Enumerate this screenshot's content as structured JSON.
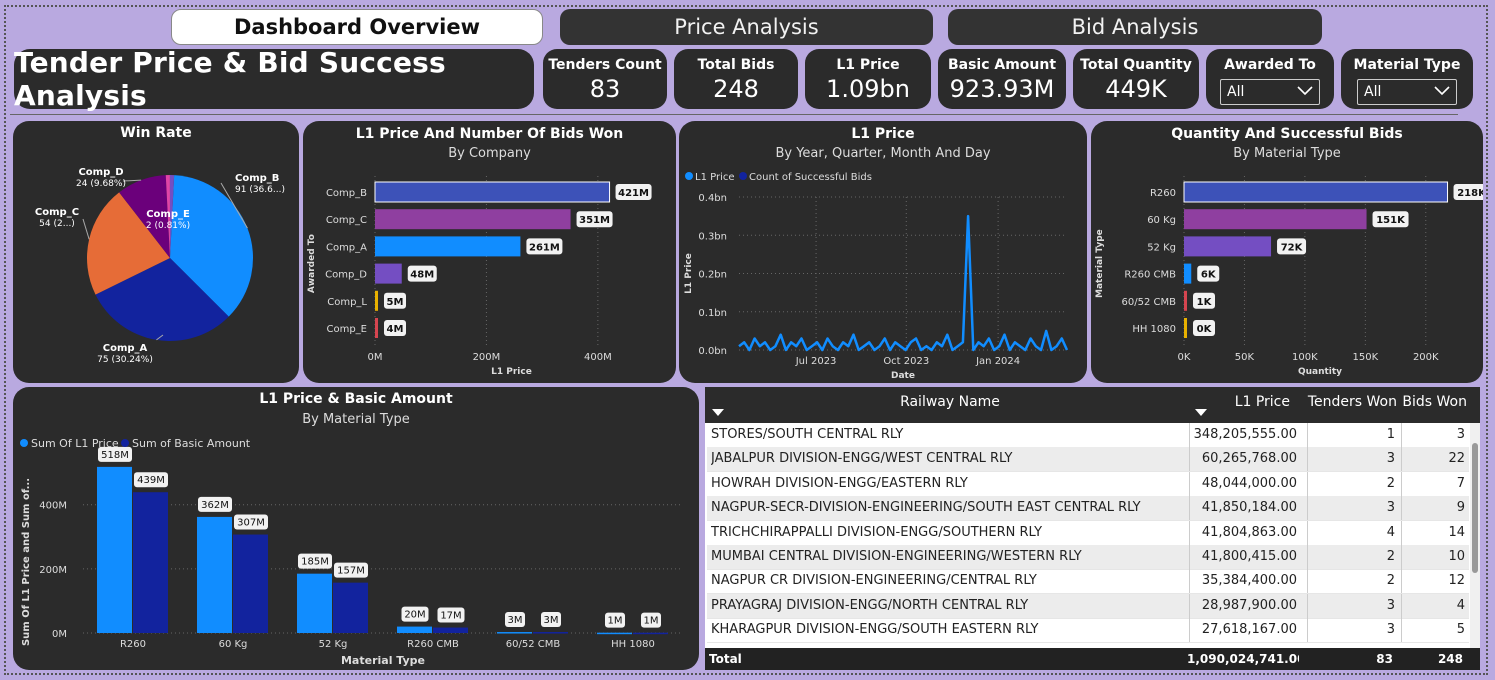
{
  "tabs": [
    {
      "label": "Dashboard Overview",
      "active": true
    },
    {
      "label": "Price Analysis",
      "active": false
    },
    {
      "label": "Bid Analysis",
      "active": false
    }
  ],
  "dashboard_title": "Tender Price & Bid Success Analysis",
  "kpis": [
    {
      "label": "Tenders Count",
      "value": "83"
    },
    {
      "label": "Total Bids",
      "value": "248"
    },
    {
      "label": "L1 Price",
      "value": "1.09bn"
    },
    {
      "label": "Basic Amount",
      "value": "923.93M"
    },
    {
      "label": "Total Quantity",
      "value": "449K"
    }
  ],
  "slicers": [
    {
      "label": "Awarded To",
      "selected": "All"
    },
    {
      "label": "Material Type",
      "selected": "All"
    }
  ],
  "chart_data": [
    {
      "id": "win-rate",
      "type": "pie",
      "title": "Win Rate",
      "slices": [
        {
          "name": "Comp_B",
          "value": 91,
          "label": "91 (36.6...)",
          "color": "#118dff"
        },
        {
          "name": "Comp_A",
          "value": 75,
          "label": "75 (30.24%)",
          "color": "#12239e"
        },
        {
          "name": "Comp_C",
          "value": 54,
          "label": "54 (2...)",
          "color": "#e66c37"
        },
        {
          "name": "Comp_D",
          "value": 24,
          "label": "24 (9.68%)",
          "color": "#6b007b"
        },
        {
          "name": "Comp_L",
          "value": 2,
          "label": "",
          "color": "#e044a7"
        },
        {
          "name": "Comp_E",
          "value": 2,
          "label": "2 (0.81%)",
          "color": "#744ec2"
        }
      ]
    },
    {
      "id": "l1-by-company",
      "type": "bar",
      "orientation": "horizontal",
      "title": "L1 Price And Number Of Bids Won",
      "subtitle": "By Company",
      "xlabel": "L1 Price",
      "ylabel": "Awarded To",
      "xlim": [
        0,
        490
      ],
      "xticks": [
        {
          "v": 0,
          "t": "0M"
        },
        {
          "v": 200,
          "t": "200M"
        },
        {
          "v": 400,
          "t": "400M"
        }
      ],
      "categories": [
        "Comp_B",
        "Comp_C",
        "Comp_A",
        "Comp_D",
        "Comp_L",
        "Comp_E"
      ],
      "values": [
        421,
        351,
        261,
        48,
        5,
        4
      ],
      "labels": [
        "421M",
        "351M",
        "261M",
        "48M",
        "5M",
        "4M"
      ],
      "colors": [
        "#3d52b8",
        "#8f3fa0",
        "#118dff",
        "#744ec2",
        "#e8b100",
        "#d64550"
      ]
    },
    {
      "id": "l1-by-date",
      "type": "line",
      "title": "L1 Price",
      "subtitle": "By Year, Quarter, Month And Day",
      "legend": [
        "L1 Price",
        "Count of Successful Bids"
      ],
      "legend_colors": [
        "#118dff",
        "#12239e"
      ],
      "xlabel": "Date",
      "ylabel": "L1 Price",
      "ylim": [
        0,
        0.4
      ],
      "yticks": [
        {
          "v": 0,
          "t": "0.0bn"
        },
        {
          "v": 0.1,
          "t": "0.1bn"
        },
        {
          "v": 0.2,
          "t": "0.2bn"
        },
        {
          "v": 0.3,
          "t": "0.3bn"
        },
        {
          "v": 0.4,
          "t": "0.4bn"
        }
      ],
      "xticks": [
        "Jul 2023",
        "Oct 2023",
        "Jan 2024"
      ],
      "values": [
        0.01,
        0.02,
        0.0,
        0.03,
        0.01,
        0.02,
        0.0,
        0.01,
        0.04,
        0.0,
        0.02,
        0.01,
        0.03,
        0.0,
        0.01,
        0.02,
        0.0,
        0.03,
        0.01,
        0.0,
        0.02,
        0.01,
        0.04,
        0.0,
        0.01,
        0.02,
        0.0,
        0.01,
        0.03,
        0.0,
        0.02,
        0.01,
        0.0,
        0.02,
        0.03,
        0.0,
        0.01,
        0.0,
        0.02,
        0.01,
        0.04,
        0.0,
        0.01,
        0.02,
        0.35,
        0.0,
        0.02,
        0.01,
        0.03,
        0.0,
        0.01,
        0.04,
        0.0,
        0.02,
        0.01,
        0.0,
        0.03,
        0.01,
        0.0,
        0.05,
        0.0,
        0.01,
        0.03,
        0.0
      ]
    },
    {
      "id": "qty-by-material",
      "type": "bar",
      "orientation": "horizontal",
      "title": "Quantity And Successful Bids",
      "subtitle": "By Material Type",
      "xlabel": "Quantity",
      "ylabel": "Material Type",
      "xlim": [
        0,
        225
      ],
      "xticks": [
        {
          "v": 0,
          "t": "0K"
        },
        {
          "v": 50,
          "t": "50K"
        },
        {
          "v": 100,
          "t": "100K"
        },
        {
          "v": 150,
          "t": "150K"
        },
        {
          "v": 200,
          "t": "200K"
        }
      ],
      "categories": [
        "R260",
        "60 Kg",
        "52 Kg",
        "R260 CMB",
        "60/52 CMB",
        "HH 1080"
      ],
      "values": [
        218,
        151,
        72,
        6,
        1,
        0.3
      ],
      "labels": [
        "218K",
        "151K",
        "72K",
        "6K",
        "1K",
        "0K"
      ],
      "colors": [
        "#3d52b8",
        "#8f3fa0",
        "#744ec2",
        "#118dff",
        "#d64550",
        "#e8b100"
      ]
    },
    {
      "id": "l1-basic-by-material",
      "type": "bar",
      "orientation": "vertical",
      "title": "L1 Price & Basic Amount",
      "subtitle": "By Material Type",
      "xlabel": "Material Type",
      "ylabel": "Sum Of L1 Price and Sum of...",
      "ylim": [
        0,
        580
      ],
      "yticks": [
        {
          "v": 0,
          "t": "0M"
        },
        {
          "v": 200,
          "t": "200M"
        },
        {
          "v": 400,
          "t": "400M"
        }
      ],
      "categories": [
        "R260",
        "60 Kg",
        "52 Kg",
        "R260 CMB",
        "60/52 CMB",
        "HH 1080"
      ],
      "series": [
        {
          "name": "Sum Of L1 Price",
          "color": "#118dff",
          "values": [
            518,
            362,
            185,
            20,
            3,
            1
          ],
          "labels": [
            "518M",
            "362M",
            "185M",
            "20M",
            "3M",
            "1M"
          ]
        },
        {
          "name": "Sum of Basic Amount",
          "color": "#12239e",
          "values": [
            439,
            307,
            157,
            17,
            3,
            1
          ],
          "labels": [
            "439M",
            "307M",
            "157M",
            "17M",
            "3M",
            "1M"
          ]
        }
      ]
    }
  ],
  "table": {
    "columns": [
      "Railway Name",
      "L1 Price",
      "Tenders Won",
      "Bids Won"
    ],
    "rows": [
      [
        "STORES/SOUTH CENTRAL RLY",
        "348,205,555.00",
        "1",
        "3"
      ],
      [
        "JABALPUR DIVISION-ENGG/WEST CENTRAL RLY",
        "60,265,768.00",
        "3",
        "22"
      ],
      [
        "HOWRAH DIVISION-ENGG/EASTERN RLY",
        "48,044,000.00",
        "2",
        "7"
      ],
      [
        "NAGPUR-SECR-DIVISION-ENGINEERING/SOUTH EAST CENTRAL RLY",
        "41,850,184.00",
        "3",
        "9"
      ],
      [
        "TRICHCHIRAPPALLI DIVISION-ENGG/SOUTHERN RLY",
        "41,804,863.00",
        "4",
        "14"
      ],
      [
        "MUMBAI CENTRAL DIVISION-ENGINEERING/WESTERN RLY",
        "41,800,415.00",
        "2",
        "10"
      ],
      [
        "NAGPUR CR DIVISION-ENGINEERING/CENTRAL RLY",
        "35,384,400.00",
        "2",
        "12"
      ],
      [
        "PRAYAGRAJ DIVISION-ENGG/NORTH CENTRAL RLY",
        "28,987,900.00",
        "3",
        "4"
      ],
      [
        "KHARAGPUR DIVISION-ENGG/SOUTH EASTERN RLY",
        "27,618,167.00",
        "3",
        "5"
      ]
    ],
    "total": [
      "Total",
      "1,090,024,741.00",
      "83",
      "248"
    ]
  }
}
